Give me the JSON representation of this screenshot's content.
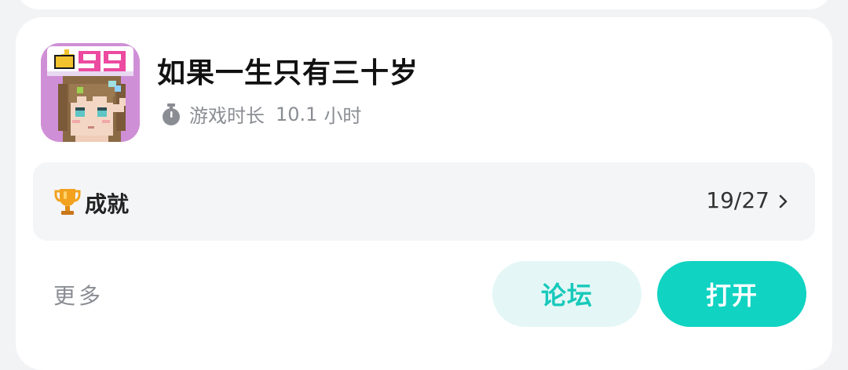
{
  "game": {
    "title": "如果一生只有三十岁",
    "icon_name": "game-avatar-pixel-girl",
    "icon_badge": "99",
    "playtime_label": "游戏时长",
    "playtime_value": "10.1",
    "playtime_unit": "小时"
  },
  "achievement": {
    "label": "成就",
    "count": "19/27"
  },
  "actions": {
    "more_label": "更多",
    "forum_label": "论坛",
    "open_label": "打开"
  },
  "colors": {
    "accent": "#10d3c2",
    "accent_light": "#e4f7f6",
    "badge_pink": "#ec4aa0",
    "trophy": "#f2a21e"
  }
}
